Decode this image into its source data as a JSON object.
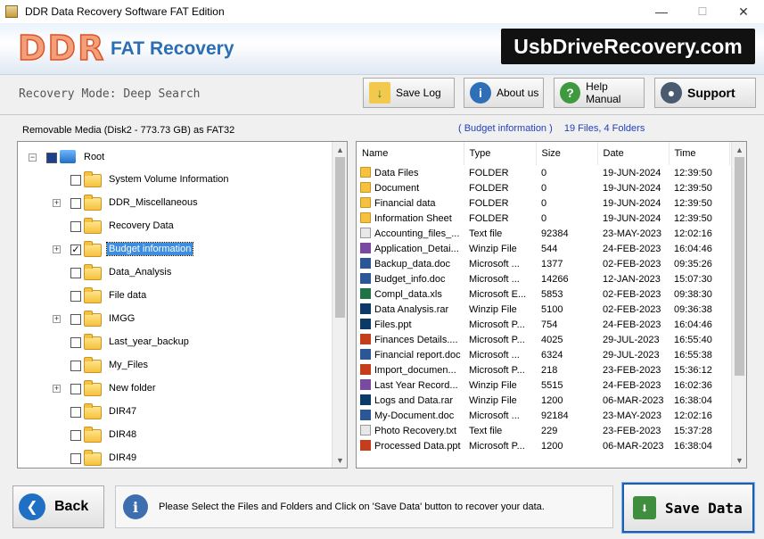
{
  "window": {
    "title": "DDR Data Recovery Software FAT Edition",
    "minimize": "—",
    "maximize": "☐",
    "close": "✕"
  },
  "banner": {
    "logo": "DDR",
    "product": "FAT Recovery",
    "site": "UsbDriveRecovery.com"
  },
  "toolbar": {
    "mode": "Recovery Mode: Deep Search",
    "save_log": "Save Log",
    "about_us": "About us",
    "help_manual": "Help Manual",
    "support": "Support"
  },
  "left_panel": {
    "header": "Removable Media (Disk2 - 773.73 GB) as FAT32",
    "root": "Root",
    "items": [
      {
        "label": "System Volume Information",
        "expandable": false,
        "checked": false,
        "selected": false
      },
      {
        "label": "DDR_Miscellaneous",
        "expandable": true,
        "checked": false,
        "selected": false
      },
      {
        "label": "Recovery Data",
        "expandable": false,
        "checked": false,
        "selected": false
      },
      {
        "label": "Budget information",
        "expandable": true,
        "checked": true,
        "selected": true
      },
      {
        "label": "Data_Analysis",
        "expandable": false,
        "checked": false,
        "selected": false
      },
      {
        "label": "File data",
        "expandable": false,
        "checked": false,
        "selected": false
      },
      {
        "label": "IMGG",
        "expandable": true,
        "checked": false,
        "selected": false
      },
      {
        "label": "Last_year_backup",
        "expandable": false,
        "checked": false,
        "selected": false
      },
      {
        "label": "My_Files",
        "expandable": false,
        "checked": false,
        "selected": false
      },
      {
        "label": "New folder",
        "expandable": true,
        "checked": false,
        "selected": false
      },
      {
        "label": "DIR47",
        "expandable": false,
        "checked": false,
        "selected": false
      },
      {
        "label": "DIR48",
        "expandable": false,
        "checked": false,
        "selected": false
      },
      {
        "label": "DIR49",
        "expandable": false,
        "checked": false,
        "selected": false
      }
    ]
  },
  "right_panel": {
    "folder": "( Budget information )",
    "count": "19 Files, 4 Folders",
    "columns": [
      "Name",
      "Type",
      "Size",
      "Date",
      "Time"
    ],
    "rows": [
      {
        "icon": "folder",
        "name": "Data Files",
        "type": "FOLDER",
        "size": "0",
        "date": "19-JUN-2024",
        "time": "12:39:50"
      },
      {
        "icon": "folder",
        "name": "Document",
        "type": "FOLDER",
        "size": "0",
        "date": "19-JUN-2024",
        "time": "12:39:50"
      },
      {
        "icon": "folder",
        "name": "Financial data",
        "type": "FOLDER",
        "size": "0",
        "date": "19-JUN-2024",
        "time": "12:39:50"
      },
      {
        "icon": "folder",
        "name": "Information Sheet",
        "type": "FOLDER",
        "size": "0",
        "date": "19-JUN-2024",
        "time": "12:39:50"
      },
      {
        "icon": "text",
        "name": "Accounting_files_...",
        "type": "Text file",
        "size": "92384",
        "date": "23-MAY-2023",
        "time": "12:02:16"
      },
      {
        "icon": "winzip",
        "name": "Application_Detai...",
        "type": "Winzip File",
        "size": "544",
        "date": "24-FEB-2023",
        "time": "16:04:46"
      },
      {
        "icon": "word",
        "name": "Backup_data.doc",
        "type": "Microsoft ...",
        "size": "1377",
        "date": "02-FEB-2023",
        "time": "09:35:26"
      },
      {
        "icon": "word",
        "name": "Budget_info.doc",
        "type": "Microsoft ...",
        "size": "14266",
        "date": "12-JAN-2023",
        "time": "15:07:30"
      },
      {
        "icon": "excel",
        "name": "Compl_data.xls",
        "type": "Microsoft E...",
        "size": "5853",
        "date": "02-FEB-2023",
        "time": "09:38:30"
      },
      {
        "icon": "ps",
        "name": "Data Analysis.rar",
        "type": "Winzip File",
        "size": "5100",
        "date": "02-FEB-2023",
        "time": "09:36:38"
      },
      {
        "icon": "ps",
        "name": "Files.ppt",
        "type": "Microsoft P...",
        "size": "754",
        "date": "24-FEB-2023",
        "time": "16:04:46"
      },
      {
        "icon": "ppt",
        "name": "Finances Details....",
        "type": "Microsoft P...",
        "size": "4025",
        "date": "29-JUL-2023",
        "time": "16:55:40"
      },
      {
        "icon": "word",
        "name": "Financial report.doc",
        "type": "Microsoft ...",
        "size": "6324",
        "date": "29-JUL-2023",
        "time": "16:55:38"
      },
      {
        "icon": "ppt",
        "name": "Import_documen...",
        "type": "Microsoft P...",
        "size": "218",
        "date": "23-FEB-2023",
        "time": "15:36:12"
      },
      {
        "icon": "winzip",
        "name": "Last Year Record...",
        "type": "Winzip File",
        "size": "5515",
        "date": "24-FEB-2023",
        "time": "16:02:36"
      },
      {
        "icon": "ps",
        "name": "Logs and Data.rar",
        "type": "Winzip File",
        "size": "1200",
        "date": "06-MAR-2023",
        "time": "16:38:04"
      },
      {
        "icon": "word",
        "name": "My-Document.doc",
        "type": "Microsoft ...",
        "size": "92184",
        "date": "23-MAY-2023",
        "time": "12:02:16"
      },
      {
        "icon": "text",
        "name": "Photo Recovery.txt",
        "type": "Text file",
        "size": "229",
        "date": "23-FEB-2023",
        "time": "15:37:28"
      },
      {
        "icon": "ppt",
        "name": "Processed Data.ppt",
        "type": "Microsoft P...",
        "size": "1200",
        "date": "06-MAR-2023",
        "time": "16:38:04"
      }
    ]
  },
  "bottom": {
    "back": "Back",
    "info": "Please Select the Files and Folders and Click on 'Save Data' button to recover your data.",
    "save_data": "Save Data"
  },
  "icon_colors": {
    "folder": "#f6c23e",
    "text": "#e8e8e8",
    "winzip": "#7a4aa0",
    "word": "#2b5797",
    "excel": "#217346",
    "ps": "#0c3a66",
    "ppt": "#c43e1c"
  }
}
